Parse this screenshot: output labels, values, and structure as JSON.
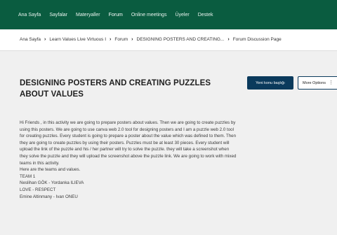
{
  "nav": {
    "items": [
      {
        "label": "Ana Sayfa",
        "name": "nav-home"
      },
      {
        "label": "Sayfalar",
        "name": "nav-pages"
      },
      {
        "label": "Materyaller",
        "name": "nav-materials"
      },
      {
        "label": "Forum",
        "name": "nav-forum"
      },
      {
        "label": "Online meetings",
        "name": "nav-online-meetings"
      },
      {
        "label": "Üyeler",
        "name": "nav-members"
      },
      {
        "label": "Destek",
        "name": "nav-support"
      }
    ]
  },
  "breadcrumb": {
    "items": [
      "Ana Sayfa",
      "Learn Values Live Virtuous I",
      "Forum",
      "DESIGNING POSTERS AND CREATING...",
      "Forum Discussion Page"
    ]
  },
  "discussion": {
    "title": "DESIGNING POSTERS AND CREATING PUZZLES ABOUT VALUES",
    "new_topic_label": "Yeni konu başlığı",
    "more_options_label": "More Options",
    "paragraph": "Hi Friends , in this activity we are going to prepare posters about values. Then we are going to create puzzles by using this posters. We are going to use canva web 2.0 tool for designing posters and I am a puzzle web 2.0 tool for creating puzzles. Every student is going to prepare a poster about the value which was defined to them. Then they are going to create puzzles by using their posters. Puzzles must be at least 30 pieces. Every student will upload the link of the puzzle and his / her partner will try to solve the puzzle. they will take a screenshot when they solve the puzzle and they will upload the screenshot above the puzzle link. We are going to work with mixed teams in this activity.",
    "teams_intro": "Here are the teams and values.",
    "team_label": "TEAM 1",
    "team_members": "Neslihan GÖK - Yordanka ILIEVA",
    "team_values": "LOVE - RESPECT",
    "cut_line": "Emine Altinmany - Ivan ONEU"
  }
}
